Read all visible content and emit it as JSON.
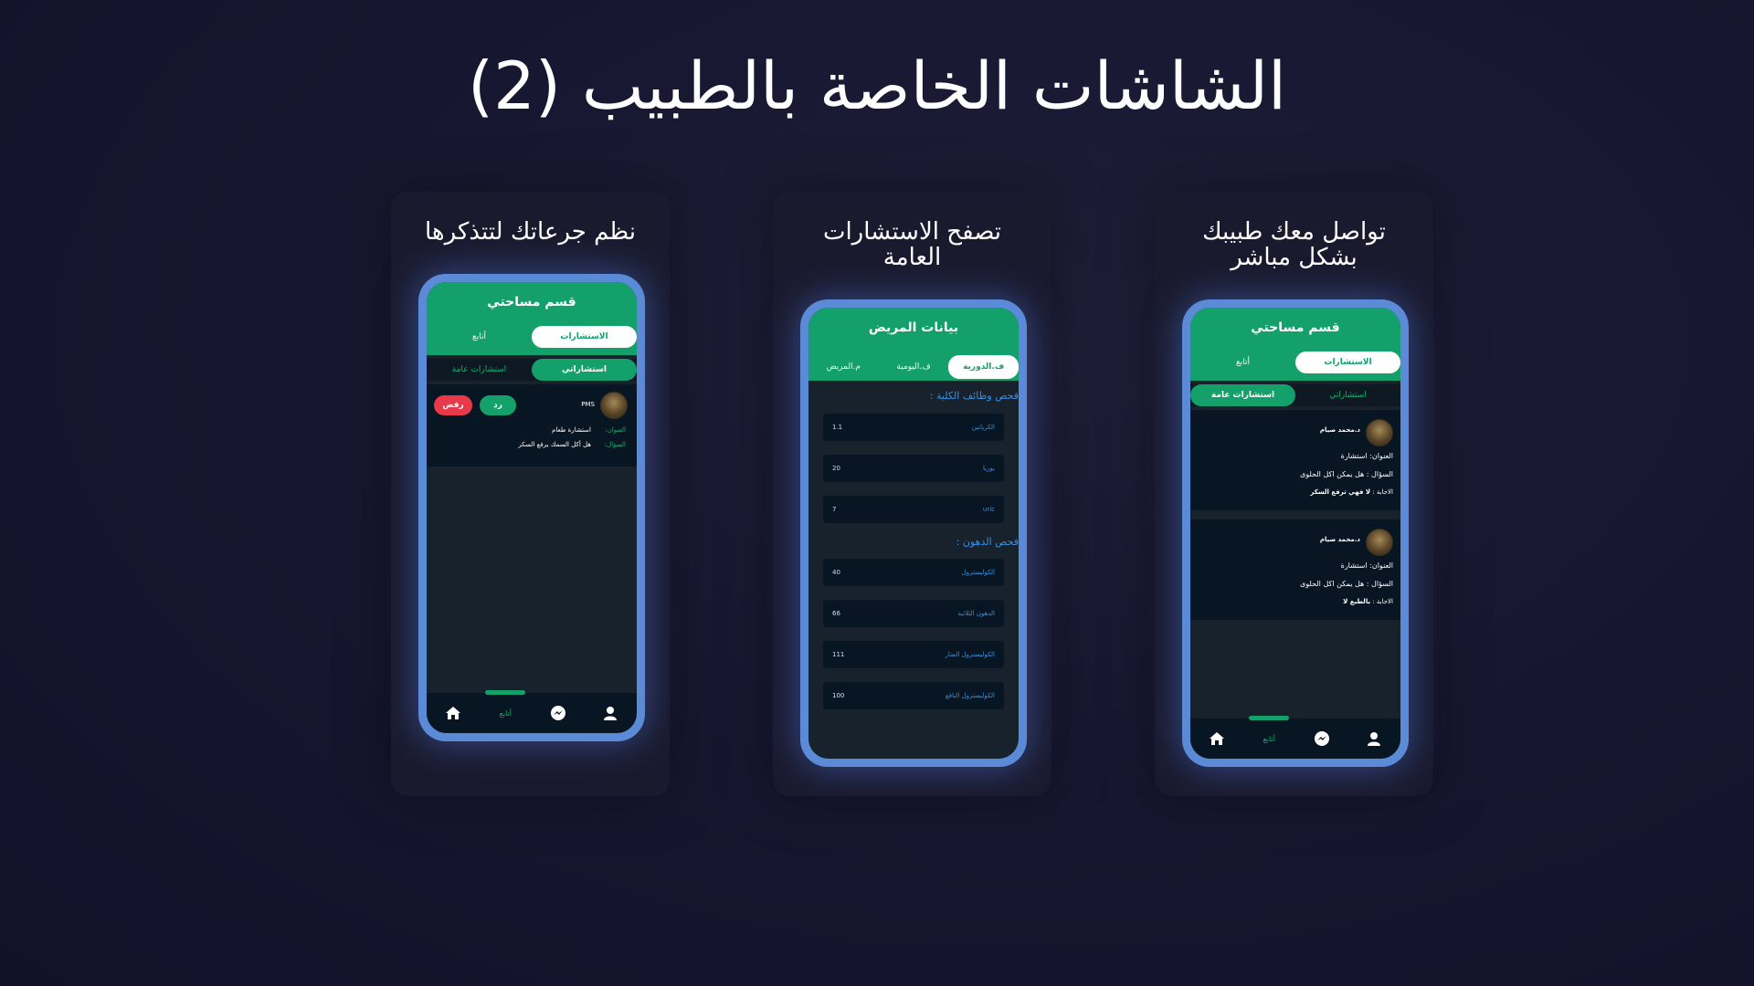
{
  "title": "الشاشات الخاصة بالطبيب (2)",
  "cards": [
    {
      "caption": "نظم جرعاتك لتتذكرها",
      "header_title": "قسم مساحتي",
      "tabs": [
        "الاستشارات",
        "أتابع"
      ],
      "sub_tabs": [
        "استشاراتي",
        "استشارات عامة"
      ],
      "consult": {
        "name": "PMS",
        "reply_label": "رد",
        "reject_label": "رفض",
        "title_key": "العنوان:",
        "title_val": "استشارة طعام",
        "question_key": "السؤال:",
        "question_val": "هل أكل السمك يرفع السكر"
      },
      "nav_follow": "أتابع"
    },
    {
      "caption_line1": "تصفح الاستشارات",
      "caption_line2": "العامة",
      "header_title": "بيانات المريض",
      "tabs": [
        "ف.الدورية",
        "ف.اليومية",
        "م.المريض"
      ],
      "section1": "فحص وظائف الكلية :",
      "rows1": [
        {
          "name": "الكرياتين",
          "value": "1.1"
        },
        {
          "name": "يوريا",
          "value": "20"
        },
        {
          "name": "uric",
          "value": "7"
        }
      ],
      "section2": "فحص الدهون :",
      "rows2": [
        {
          "name": "الكوليسترول",
          "value": "40"
        },
        {
          "name": "الدهون الثلاثية",
          "value": "66"
        },
        {
          "name": "الكوليسترول الضار",
          "value": "111"
        },
        {
          "name": "الكوليسترول النافع",
          "value": "100"
        }
      ]
    },
    {
      "caption_line1": "تواصل معك طبيبك",
      "caption_line2": "بشكل مباشر",
      "header_title": "قسم مساحتي",
      "tabs": [
        "الاستشارات",
        "أتابع"
      ],
      "sub_tabs": [
        "استشاراتي",
        "استشارات عامة"
      ],
      "consults": [
        {
          "doctor": "د.محمد صيام",
          "title": "العنوان: استشارة",
          "question": "السؤال : هل يمكن اكل الحلوى",
          "answer_key": "الاجابة : ",
          "answer_val": "لا فهي ترفع السكر"
        },
        {
          "doctor": "د.محمد صيام",
          "title": "العنوان: استشارة",
          "question": "السؤال : هل يمكن اكل الحلوى",
          "answer_key": "الاجابة : ",
          "answer_val": "بالطبع لا"
        }
      ],
      "nav_follow": "أتابع"
    }
  ]
}
